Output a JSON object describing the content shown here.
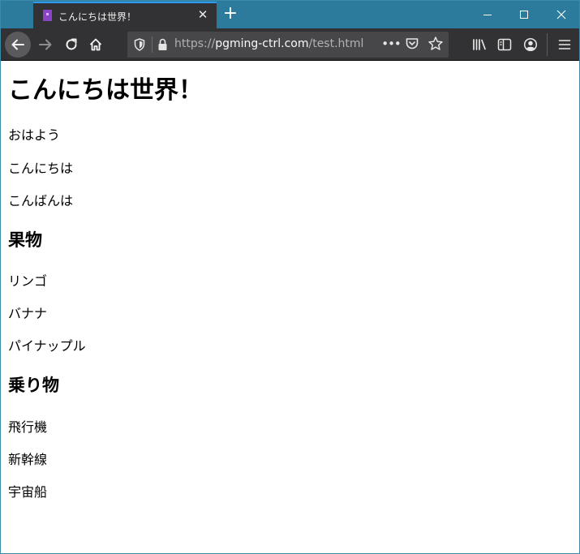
{
  "browser": {
    "tab": {
      "title": "こんにちは世界！"
    },
    "url": {
      "scheme": "https://",
      "host": "pgming-ctrl.com",
      "path": "/test.html"
    },
    "url_overflow": "•••"
  },
  "page": {
    "heading": "こんにちは世界！",
    "greetings": [
      "おはよう",
      "こんにちは",
      "こんばんは"
    ],
    "fruits_heading": "果物",
    "fruits": [
      "リンゴ",
      "バナナ",
      "パイナップル"
    ],
    "vehicles_heading": "乗り物",
    "vehicles": [
      "飛行機",
      "新幹線",
      "宇宙船"
    ]
  }
}
